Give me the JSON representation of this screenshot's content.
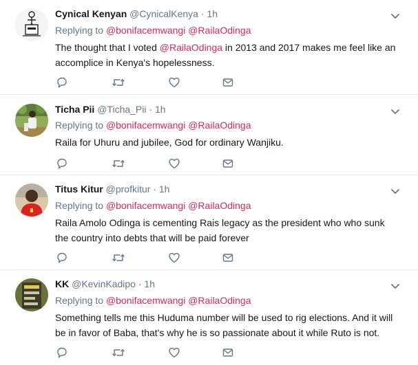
{
  "tweets": [
    {
      "name": "Cynical Kenyan",
      "handle": "@CynicalKenya",
      "dot": "·",
      "time": "1h",
      "replying_label": "Replying to",
      "mentions": [
        "@bonifacemwangi",
        "@RailaOdinga"
      ],
      "text_parts": [
        "The thought that I voted ",
        "@RailaOdinga",
        " in 2013 and 2017 makes me feel like an accomplice in Kenya's hopelessness."
      ]
    },
    {
      "name": "Ticha Pii",
      "handle": "@Ticha_Pii",
      "dot": "·",
      "time": "1h",
      "replying_label": "Replying to",
      "mentions": [
        "@bonifacemwangi",
        "@RailaOdinga"
      ],
      "text": "Raila for Uhuru and jubilee, God for ordinary Wanjiku."
    },
    {
      "name": "Titus Kitur",
      "handle": "@profkitur",
      "dot": "·",
      "time": "1h",
      "replying_label": "Replying to",
      "mentions": [
        "@bonifacemwangi",
        "@RailaOdinga"
      ],
      "text": "Raila Amolo Odinga is cementing Rais legacy as the president who who sunk the country into debts that will be paid forever"
    },
    {
      "name": "KK",
      "handle": "@KevinKadipo",
      "dot": "·",
      "time": "1h",
      "replying_label": "Replying to",
      "mentions": [
        "@bonifacemwangi",
        "@RailaOdinga"
      ],
      "text": "Something tells me this Huduma number will be used to rig elections. And it will be in favor of Baba, that's why he is so passionate about it while Ruto is not."
    }
  ],
  "icons": [
    "chevron-down-icon",
    "reply-icon",
    "retweet-icon",
    "like-icon",
    "direct-message-icon"
  ],
  "colors": {
    "mention": "#e0245e",
    "secondary_text": "#657786",
    "icon": "#657786",
    "divider": "#e6ecf0"
  }
}
